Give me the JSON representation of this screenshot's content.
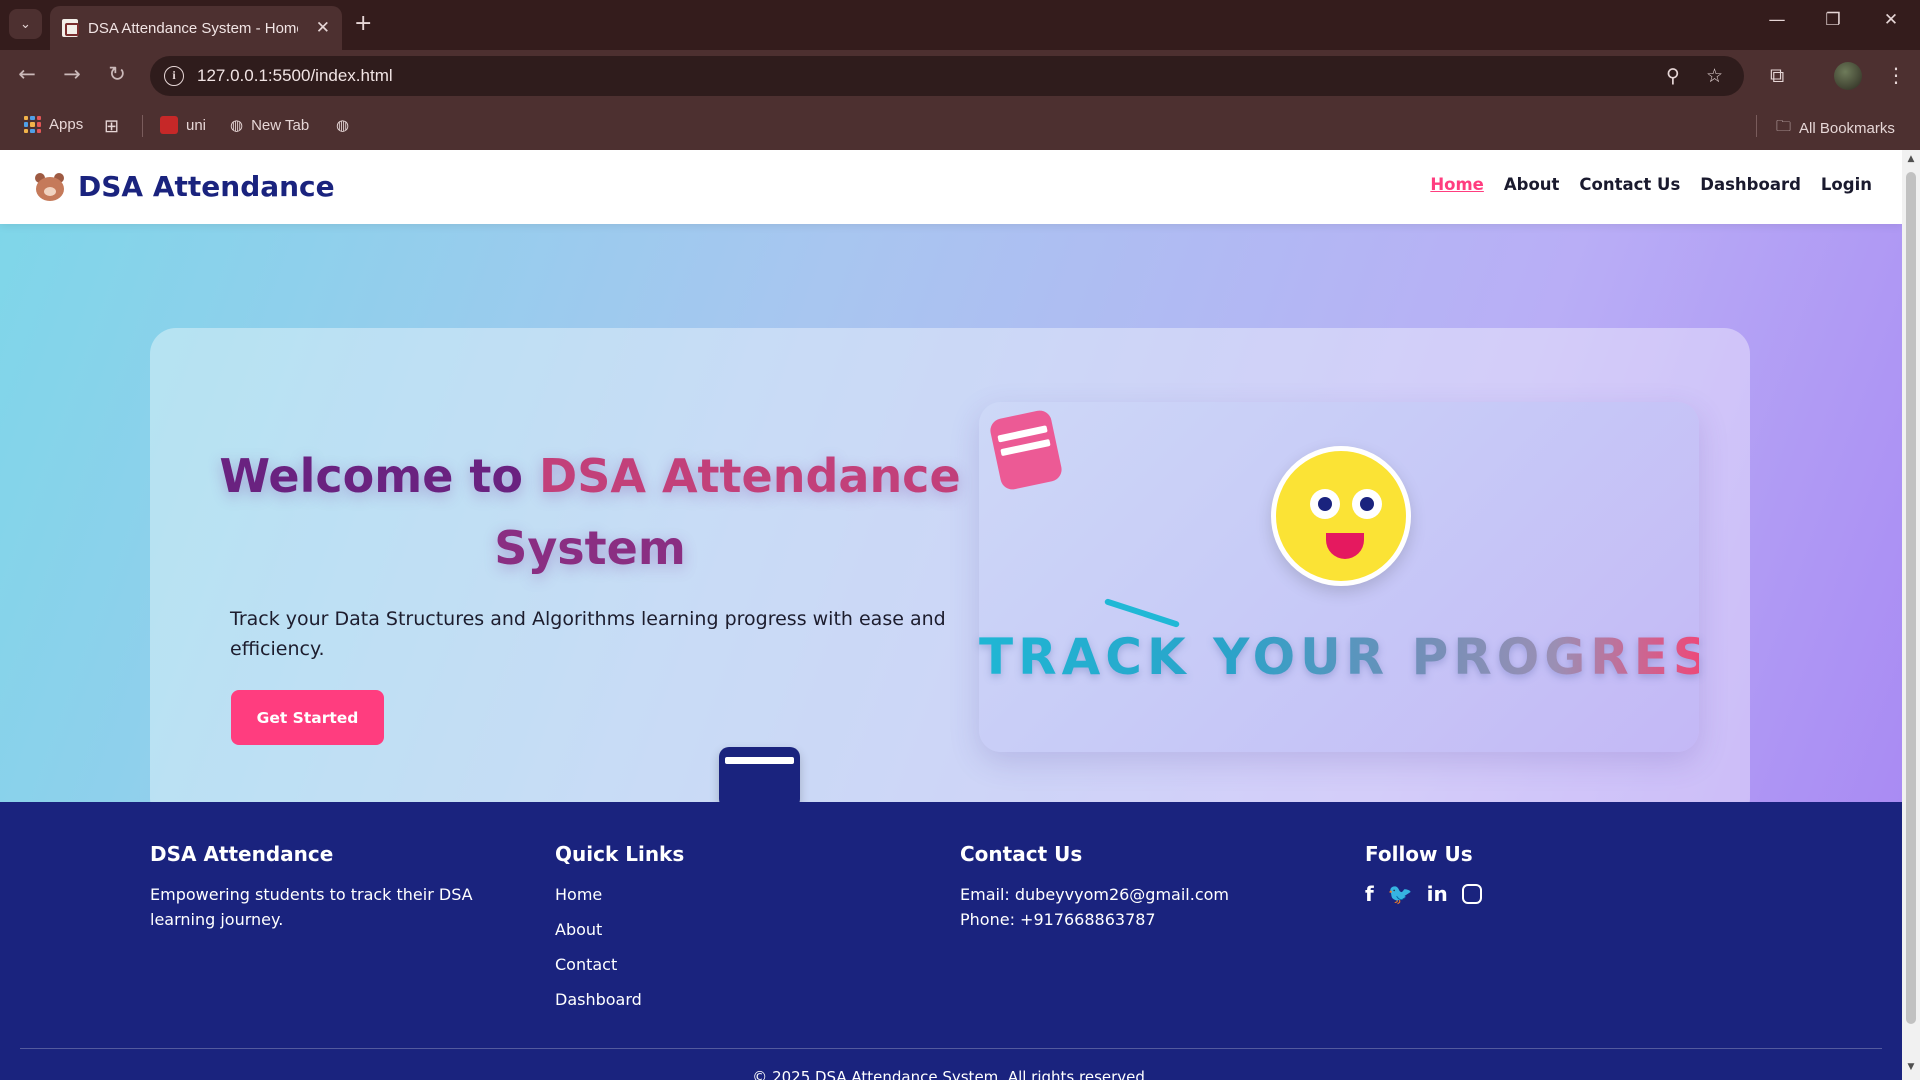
{
  "browser": {
    "tab_title": "DSA Attendance System - Home",
    "url": "127.0.0.1:5500/index.html",
    "bookmarks": [
      {
        "label": "Apps"
      },
      {
        "label": "uni"
      },
      {
        "label": "New Tab"
      }
    ],
    "all_bookmarks_label": "All Bookmarks"
  },
  "header": {
    "brand": "DSA Attendance",
    "nav": [
      {
        "label": "Home",
        "active": true
      },
      {
        "label": "About"
      },
      {
        "label": "Contact Us"
      },
      {
        "label": "Dashboard"
      },
      {
        "label": "Login"
      }
    ]
  },
  "hero": {
    "title_part1": "Welcome to ",
    "title_part2": "DSA Attendance",
    "title_part3": "System",
    "description": "Track your Data Structures and Algorithms learning progress with ease and efficiency.",
    "cta_label": "Get Started",
    "visual_text": "TRACK YOUR PROGRESS!"
  },
  "footer": {
    "about": {
      "heading": "DSA Attendance",
      "text": "Empowering students to track their DSA learning journey."
    },
    "quick_links": {
      "heading": "Quick Links",
      "items": [
        "Home",
        "About",
        "Contact",
        "Dashboard"
      ]
    },
    "contact": {
      "heading": "Contact Us",
      "email": "Email: dubeyvyom26@gmail.com",
      "phone": "Phone: +917668863787"
    },
    "follow": {
      "heading": "Follow Us",
      "icons": [
        "facebook-icon",
        "twitter-icon",
        "linkedin-icon",
        "instagram-icon"
      ]
    },
    "copyright": "© 2025 DSA Attendance System. All rights reserved."
  },
  "colors": {
    "brand_navy": "#1a237e",
    "accent_pink": "#ff3d7f",
    "chrome_bg": "#4d3030"
  }
}
